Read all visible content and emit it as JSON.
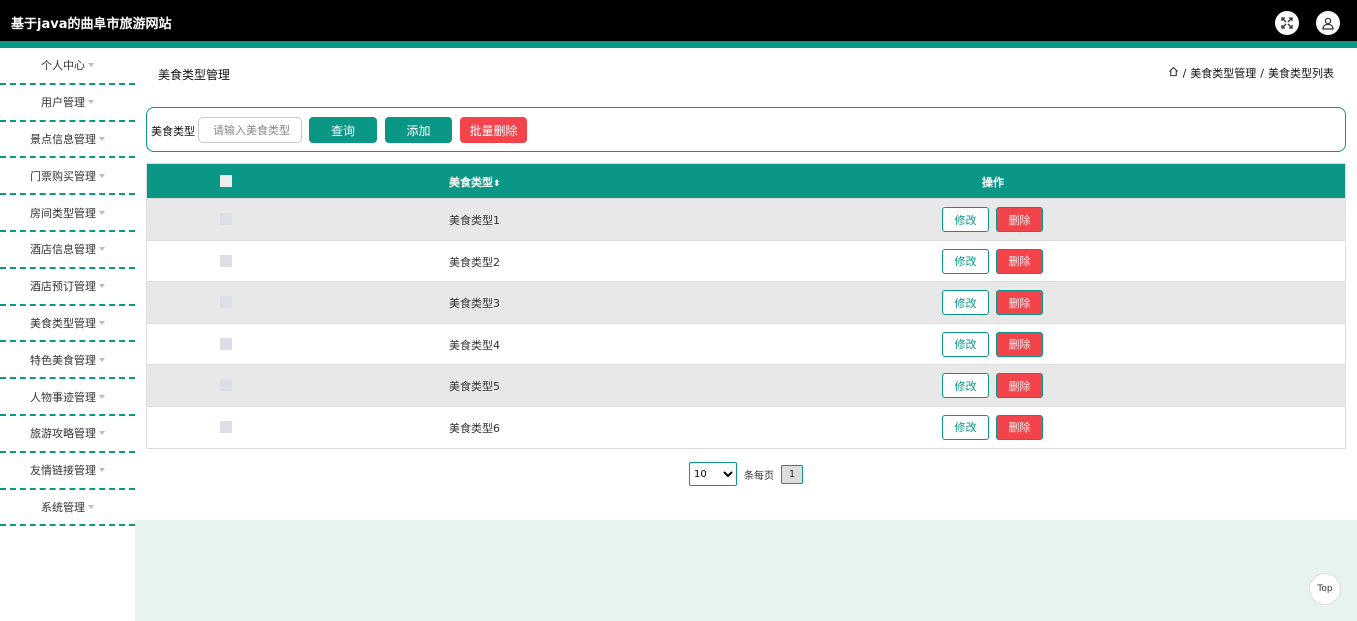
{
  "app": {
    "title": "基于java的曲阜市旅游网站"
  },
  "header": {
    "icons": [
      "fullscreen-icon",
      "user-icon"
    ]
  },
  "sidebar": {
    "items": [
      {
        "label": "个人中心"
      },
      {
        "label": "用户管理"
      },
      {
        "label": "景点信息管理"
      },
      {
        "label": "门票购买管理"
      },
      {
        "label": "房间类型管理"
      },
      {
        "label": "酒店信息管理"
      },
      {
        "label": "酒店预订管理"
      },
      {
        "label": "美食类型管理"
      },
      {
        "label": "特色美食管理"
      },
      {
        "label": "人物事迹管理"
      },
      {
        "label": "旅游攻略管理"
      },
      {
        "label": "友情链接管理"
      },
      {
        "label": "系统管理"
      }
    ]
  },
  "page": {
    "title": "美食类型管理",
    "breadcrumb": {
      "sep1": "/",
      "item1": "美食类型管理",
      "sep2": "/",
      "item2": "美食类型列表"
    }
  },
  "search": {
    "label": "美食类型",
    "placeholder": "请输入美食类型",
    "query_label": "查询",
    "add_label": "添加",
    "batch_delete_label": "批量删除"
  },
  "table": {
    "headers": {
      "type": "美食类型",
      "sort_icon": "sort-icon",
      "ops": "操作"
    },
    "rows": [
      {
        "type": "美食类型1",
        "edit": "修改",
        "delete": "删除"
      },
      {
        "type": "美食类型2",
        "edit": "修改",
        "delete": "删除"
      },
      {
        "type": "美食类型3",
        "edit": "修改",
        "delete": "删除"
      },
      {
        "type": "美食类型4",
        "edit": "修改",
        "delete": "删除"
      },
      {
        "type": "美食类型5",
        "edit": "修改",
        "delete": "删除"
      },
      {
        "type": "美食类型6",
        "edit": "修改",
        "delete": "删除"
      }
    ]
  },
  "pagination": {
    "page_size": "10",
    "per_page_label": "条每页",
    "current_page": "1"
  },
  "back_to_top": "Top",
  "colors": {
    "accent": "#0a9786",
    "danger": "#f2444a",
    "header_bg": "#000000",
    "footer_bg": "#e6f3ee"
  }
}
